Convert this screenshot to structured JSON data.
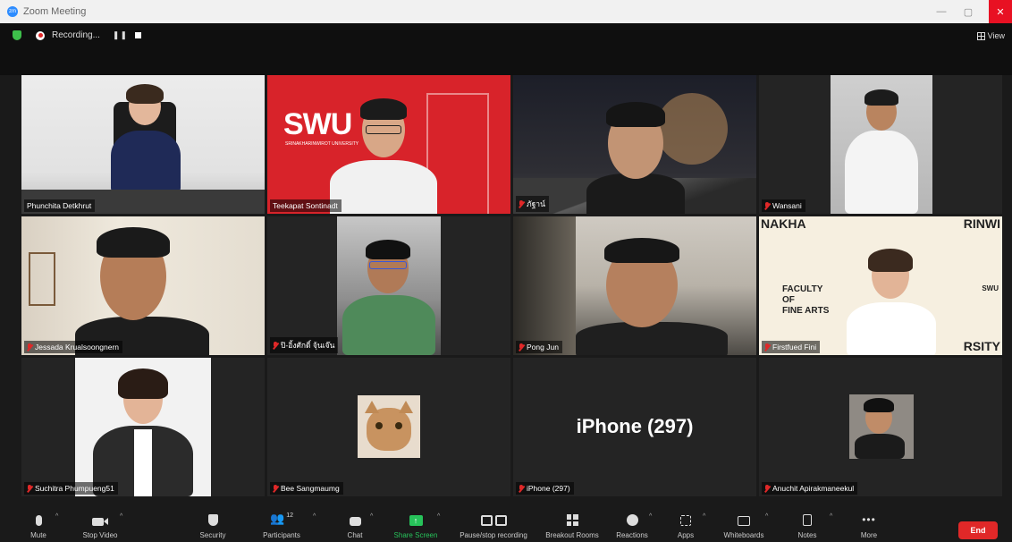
{
  "window": {
    "title": "Zoom Meeting",
    "app_icon_text": "zm"
  },
  "recording": {
    "label": "Recording...",
    "pause_glyph": "❚❚"
  },
  "view": {
    "label": "View"
  },
  "participants": [
    {
      "name": "Phunchita Detkhrut",
      "muted": false
    },
    {
      "name": "Teekapat Sontinadt",
      "muted": false,
      "active": true,
      "logo_text": "SWU",
      "logo_sub": "SRINAKHARINWIROT UNIVERSITY"
    },
    {
      "name": "ภัฐาน์",
      "muted": true
    },
    {
      "name": "Wansani",
      "muted": true
    },
    {
      "name": "Jessada Krualsoongnern",
      "muted": true
    },
    {
      "name": "ปิ-อิ้งศักดิ์ จุ้นเจ๊น",
      "muted": true
    },
    {
      "name": "Pong Jun",
      "muted": true
    },
    {
      "name": "Firstfued Fini",
      "muted": true,
      "bg_lines": [
        "NAKHA",
        "RINWI",
        "FACULTY",
        "OF",
        "FINE ARTS",
        "RSITY"
      ],
      "logo_text": "SWU"
    },
    {
      "name": "Suchitra Phumpueng51",
      "muted": true
    },
    {
      "name": "Bee Sangmaumg",
      "muted": true
    },
    {
      "name": "iPhone (297)",
      "muted": true,
      "display_text": "iPhone (297)"
    },
    {
      "name": "Anuchit Apirakmaneekul",
      "muted": true
    }
  ],
  "toolbar": {
    "mute": "Mute",
    "stop_video": "Stop Video",
    "security": "Security",
    "participants": "Participants",
    "participants_count": "12",
    "chat": "Chat",
    "share_screen": "Share Screen",
    "pause_recording": "Pause/stop recording",
    "breakout_rooms": "Breakout Rooms",
    "reactions": "Reactions",
    "apps": "Apps",
    "whiteboards": "Whiteboards",
    "notes": "Notes",
    "more": "More",
    "end": "End"
  },
  "colors": {
    "accent_green": "#27c25a",
    "end_red": "#e02828",
    "active_speaker": "#f4d03f",
    "swu_red": "#d8232a"
  }
}
